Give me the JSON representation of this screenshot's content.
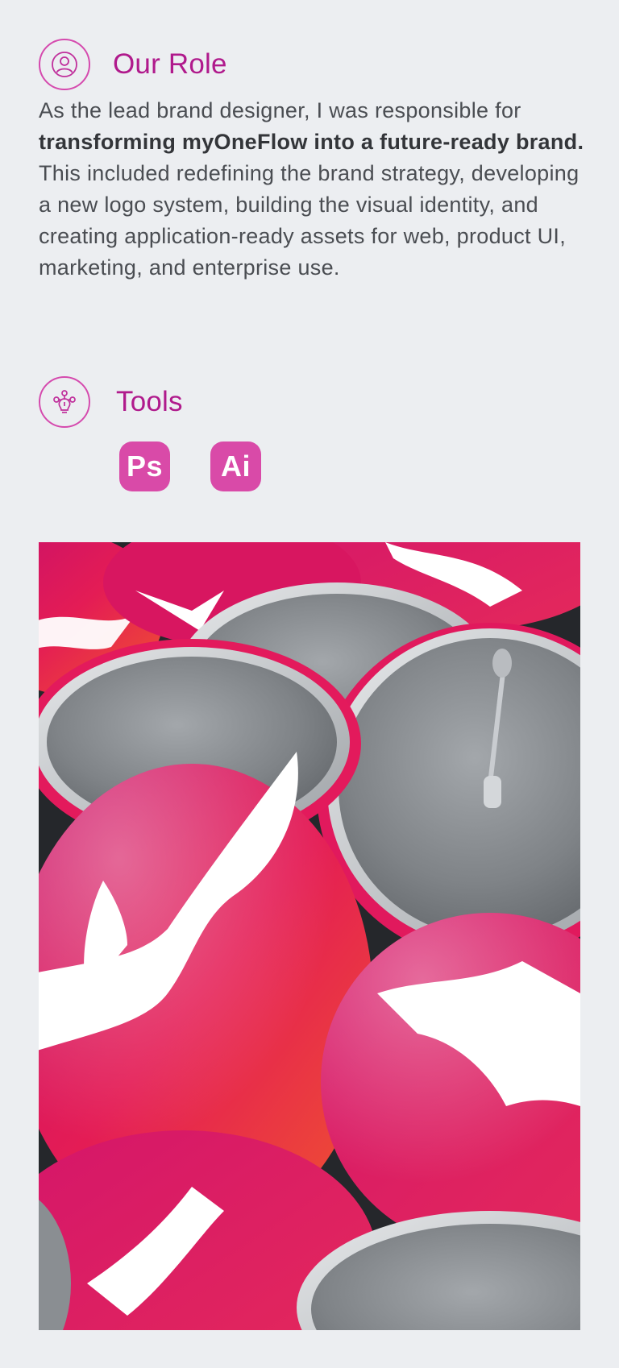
{
  "role": {
    "title": "Our Role",
    "icon": "user-circle-icon",
    "intro": "As the lead brand designer, I was responsible for",
    "highlight": "transforming myOneFlow into a future-ready brand.",
    "details": "This included redefining the brand strategy, developing a new logo system, building the visual identity, and creating application-ready assets for web, product UI, marketing, and enterprise use."
  },
  "tools": {
    "title": "Tools",
    "icon": "brain-network-icon",
    "items": [
      {
        "label": "Ps",
        "icon": "photoshop-icon"
      },
      {
        "label": "Ai",
        "icon": "illustrator-icon"
      }
    ]
  },
  "colors": {
    "accent": "#b01a8c",
    "badge": "#d94aa8",
    "background": "#eceef1",
    "pin_pink": "#e3195a",
    "pin_silver": "#8e9296"
  }
}
